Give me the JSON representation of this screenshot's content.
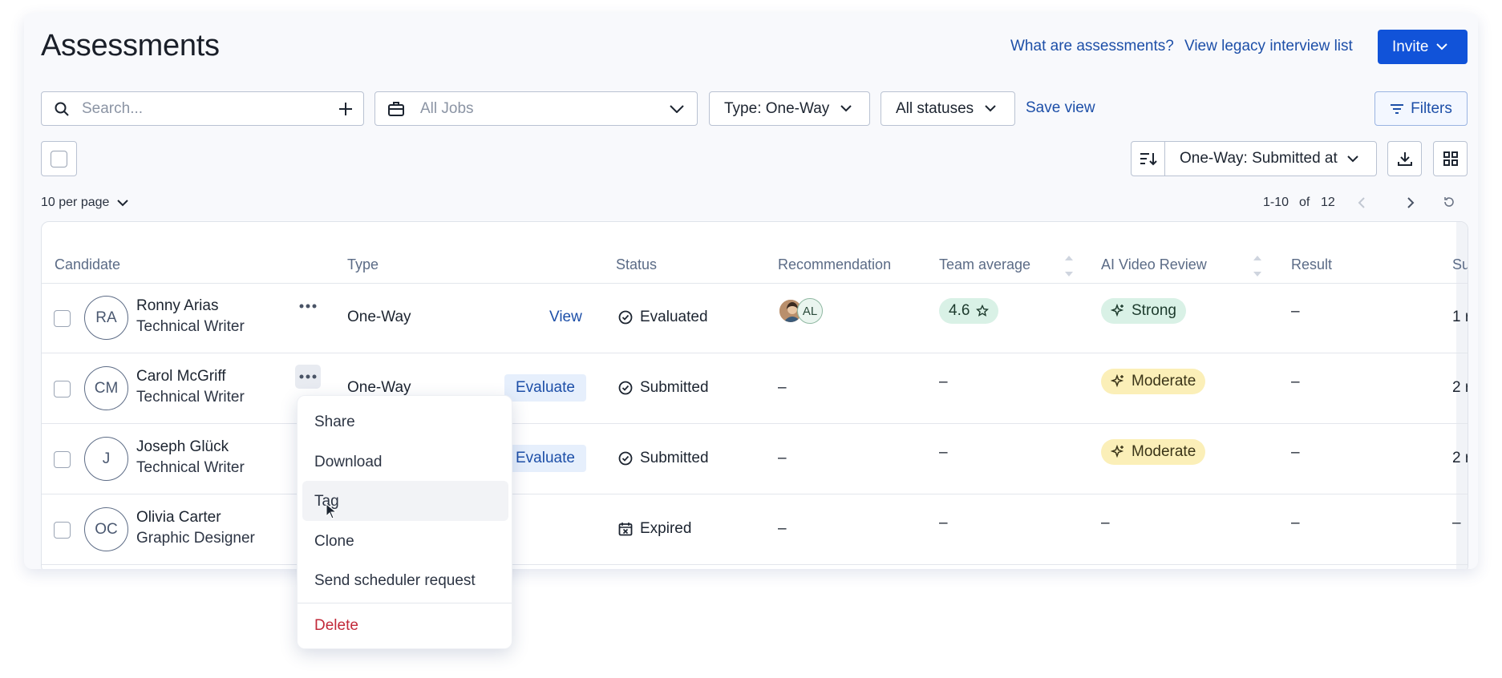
{
  "header": {
    "title": "Assessments",
    "link_what": "What are assessments?",
    "link_legacy": "View legacy interview list",
    "invite_label": "Invite"
  },
  "toolbar": {
    "search_placeholder": "Search...",
    "jobs_placeholder": "All Jobs",
    "type_filter": "Type: One-Way",
    "status_filter": "All statuses",
    "save_view": "Save view",
    "filters": "Filters",
    "sort_label": "One-Way: Submitted at"
  },
  "pagination": {
    "per_page": "10 per page",
    "range": "1-10",
    "of": "of",
    "total": "12"
  },
  "table": {
    "columns": [
      "Candidate",
      "Type",
      "Status",
      "Recommendation",
      "Team average",
      "AI Video Review",
      "Result",
      "Su"
    ],
    "rows": [
      {
        "initials": "RA",
        "name": "Ronny Arias",
        "role": "Technical Writer",
        "type": "One-Way",
        "action": "View",
        "status": "Evaluated",
        "recommendation": "AL",
        "team_avg": "4.6",
        "ai_review": "Strong",
        "result": "–",
        "submitted": "1 r"
      },
      {
        "initials": "CM",
        "name": "Carol McGriff",
        "role": "Technical Writer",
        "type": "One-Way",
        "action": "Evaluate",
        "status": "Submitted",
        "recommendation": "–",
        "team_avg": "–",
        "ai_review": "Moderate",
        "result": "–",
        "submitted": "2 r"
      },
      {
        "initials": "J",
        "name": "Joseph Glück",
        "role": "Technical Writer",
        "type": "",
        "action": "Evaluate",
        "status": "Submitted",
        "recommendation": "–",
        "team_avg": "–",
        "ai_review": "Moderate",
        "result": "–",
        "submitted": "2 r"
      },
      {
        "initials": "OC",
        "name": "Olivia Carter",
        "role": "Graphic Designer",
        "type": "",
        "action": "",
        "status": "Expired",
        "recommendation": "–",
        "team_avg": "–",
        "ai_review": "–",
        "result": "–",
        "submitted": "–"
      }
    ]
  },
  "context_menu": {
    "items": [
      "Share",
      "Download",
      "Tag",
      "Clone",
      "Send scheduler request",
      "Delete"
    ]
  },
  "colors": {
    "accent": "#1153d9",
    "link": "#1d4fa8",
    "strong_bg": "#d9f1e6",
    "moderate_bg": "#fbefb8",
    "danger": "#c22a3a"
  }
}
